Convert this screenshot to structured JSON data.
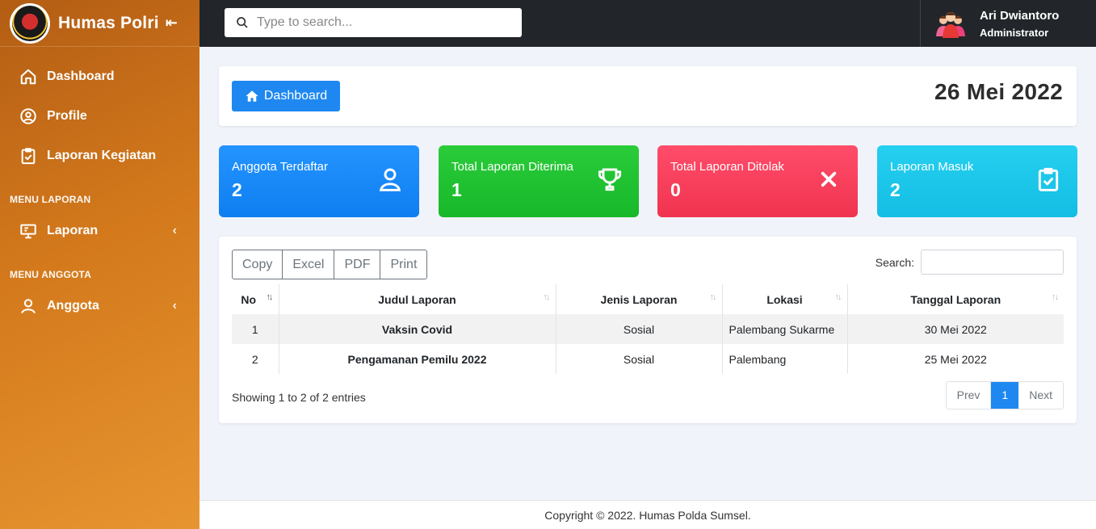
{
  "sidebar": {
    "brand": "Humas Polri",
    "collapse_icon": "⇤",
    "items": [
      {
        "label": "Dashboard",
        "icon": "home-icon"
      },
      {
        "label": "Profile",
        "icon": "user-circle-icon"
      },
      {
        "label": "Laporan Kegiatan",
        "icon": "clipboard-check-icon"
      }
    ],
    "heading_laporan": "MENU LAPORAN",
    "laporan": {
      "label": "Laporan",
      "icon": "presentation-icon",
      "chevron": "‹"
    },
    "heading_anggota": "MENU ANGGOTA",
    "anggota": {
      "label": "Anggota",
      "icon": "user-icon",
      "chevron": "‹"
    }
  },
  "topbar": {
    "search_placeholder": "Type to search...",
    "user_name": "Ari Dwiantoro",
    "user_role": "Administrator"
  },
  "header": {
    "button_label": "Dashboard",
    "date": "26 Mei 2022"
  },
  "stats": [
    {
      "label": "Anggota Terdaftar",
      "value": "2",
      "icon": "user-icon",
      "color": "#1a8cff"
    },
    {
      "label": "Total Laporan Diterima",
      "value": "1",
      "icon": "trophy-icon",
      "color": "#22c232"
    },
    {
      "label": "Total Laporan Ditolak",
      "value": "0",
      "icon": "close-icon",
      "color": "#f7405c"
    },
    {
      "label": "Laporan Masuk",
      "value": "2",
      "icon": "clipboard-check-icon",
      "color": "#1cc7ea"
    }
  ],
  "table": {
    "buttons": [
      "Copy",
      "Excel",
      "PDF",
      "Print"
    ],
    "search_label": "Search:",
    "columns": [
      "No",
      "Judul Laporan",
      "Jenis Laporan",
      "Lokasi",
      "Tanggal Laporan"
    ],
    "rows": [
      [
        "1",
        "Vaksin Covid",
        "Sosial",
        "Palembang Sukarme",
        "30 Mei 2022"
      ],
      [
        "2",
        "Pengamanan Pemilu 2022",
        "Sosial",
        "Palembang",
        "25 Mei 2022"
      ]
    ],
    "info": "Showing 1 to 2 of 2 entries",
    "pager": {
      "prev": "Prev",
      "page": "1",
      "next": "Next"
    }
  },
  "footer": "Copyright © 2022. Humas Polda Sumsel."
}
